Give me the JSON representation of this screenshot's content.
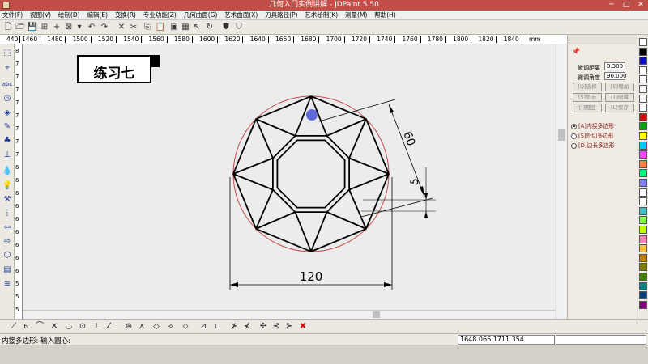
{
  "window": {
    "title": "几何入门实例讲解 - JDPaint 5.50",
    "minimize_glyph": "─",
    "maximize_glyph": "□",
    "close_glyph": "✕"
  },
  "menu": [
    "文件(F)",
    "视图(V)",
    "绘制(D)",
    "编辑(E)",
    "变换(R)",
    "专业功能(Z)",
    "几何曲面(G)",
    "艺术曲面(X)",
    "刀具路径(P)",
    "艺术绘制(K)",
    "测量(M)",
    "帮助(H)"
  ],
  "toolbar": [
    "🗋",
    "🗁",
    "💾",
    "⊞",
    "+",
    "⊠",
    "▾",
    "↶",
    "↷",
    "✕",
    "✂",
    "⎘",
    "📋",
    "▣",
    "▦",
    "↖",
    "↻",
    "⛊",
    "⛉"
  ],
  "ruler": {
    "labels": [
      "440",
      "1460",
      "1480",
      "1500",
      "1520",
      "1540",
      "1560",
      "1580",
      "1600",
      "1620",
      "1640",
      "1660",
      "1680",
      "1700",
      "1720",
      "1740",
      "1760",
      "1780",
      "1800",
      "1820",
      "1840",
      "mm"
    ],
    "left_labels": [
      "8",
      "7",
      "7",
      "7",
      "7",
      "7",
      "7",
      "7",
      "7",
      "6",
      "6",
      "6",
      "6",
      "6",
      "6",
      "6",
      "6",
      "6",
      "5",
      "5",
      "5"
    ]
  },
  "left_tools": [
    "⬚",
    "⌖",
    "abc",
    "◎",
    "◈",
    "✎",
    "♣",
    "⊥",
    "💧",
    "💡",
    "⚒",
    "⋮",
    "⇦",
    "⇨",
    "⬡",
    "▤",
    "≋"
  ],
  "canvas": {
    "exercise_title": "练习七"
  },
  "drawing": {
    "dim_width": "120",
    "dim_radius": "60",
    "dim_offset": "5",
    "outer_circle_color": "#c84a4a",
    "line_color": "#000000",
    "cursor_color": "#2f3fcf"
  },
  "panel": {
    "pin_icon": "📌",
    "step_distance_label": "微调距离",
    "step_distance_value": "0.300",
    "step_angle_label": "微调角度",
    "step_angle_value": "90.000",
    "buttons": [
      "[Q]选择",
      "[E]增加",
      "[S]显示",
      "[T]隐藏",
      "[J]图层",
      "[L]保存"
    ],
    "radios": [
      "[A]内接多边形",
      "[S]外切多边形",
      "[D]边长多边形"
    ]
  },
  "palette": [
    "#ffffff",
    "#000000",
    "#1010c0",
    "#ffffff",
    "#ffffff",
    "#ffffff",
    "#ffffff",
    "#ffffff",
    "#d01010",
    "#10a010",
    "#ffff00",
    "#00c8ff",
    "#ff40ff",
    "#ff8040",
    "#00ff80",
    "#8080ff",
    "#ffffff",
    "#ffffff",
    "#40c0c0",
    "#80ff40",
    "#c0ff00",
    "#ff80c0",
    "#ffc040",
    "#c08000",
    "#808000",
    "#408000",
    "#008080",
    "#004080",
    "#800080"
  ],
  "bottom_tools": [
    "⟋",
    "⊾",
    "⌒",
    "✕",
    "◡",
    "⊙",
    "⊥",
    "∠",
    "⊛",
    "⋏",
    "◇",
    "⟡",
    "⬦",
    "⊿",
    "⊏",
    "⊁",
    "⊀",
    "✢",
    "⊰",
    "⊱",
    "✖"
  ],
  "status": {
    "prompt": "内接多边形: 输入圆心:",
    "coordinates": "1648.066  1711.354"
  }
}
